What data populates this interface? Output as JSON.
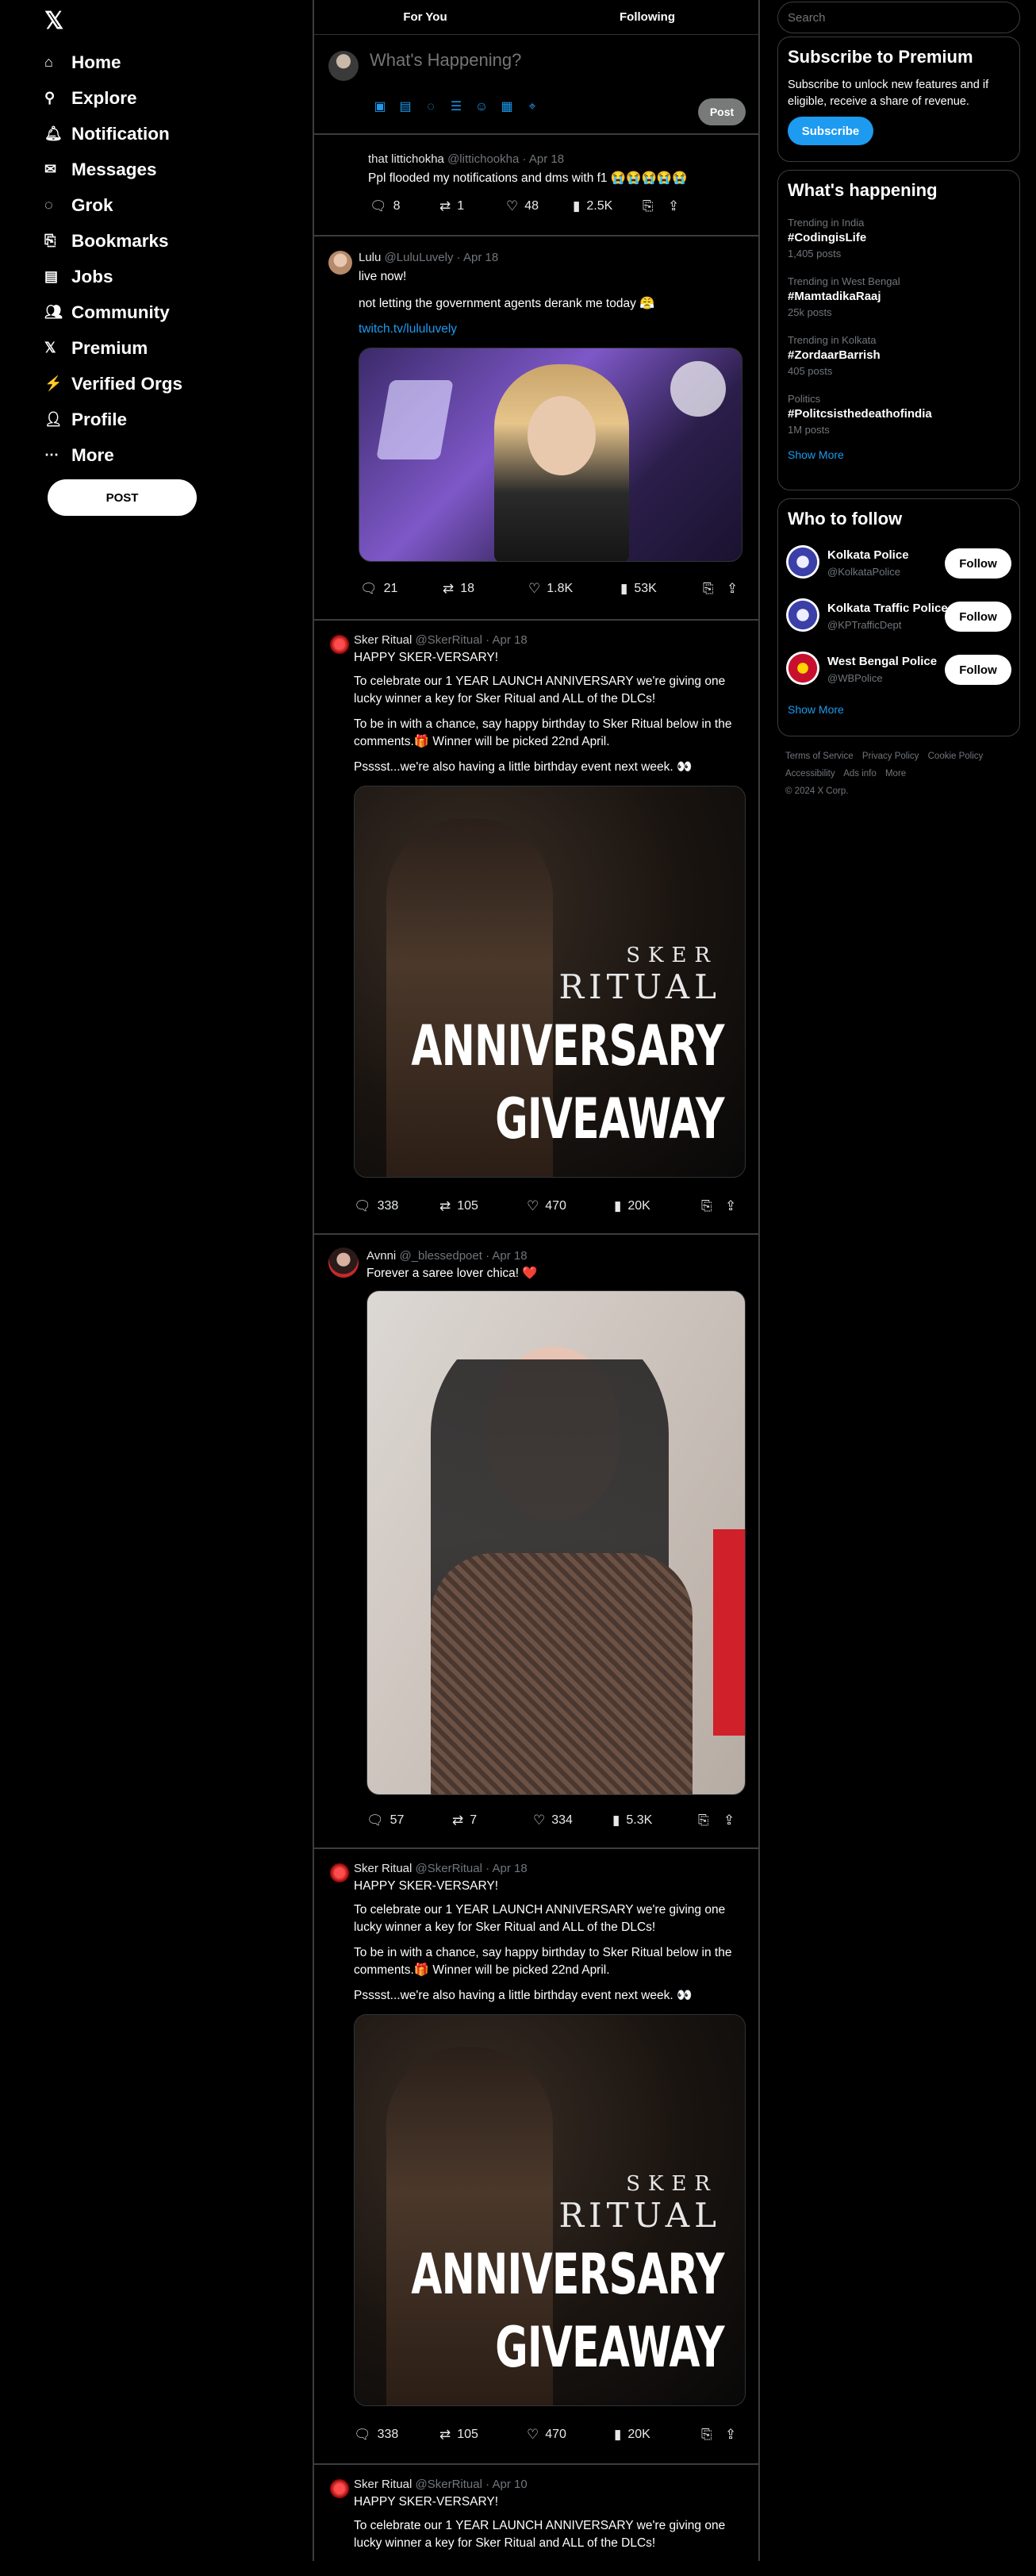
{
  "sidebar": {
    "logo": "𝕏",
    "items": [
      {
        "label": "Home",
        "icon": "⌂"
      },
      {
        "label": "Explore",
        "icon": "⚲"
      },
      {
        "label": "Notification",
        "icon": "🔔︎"
      },
      {
        "label": "Messages",
        "icon": "✉"
      },
      {
        "label": "Grok",
        "icon": "◌"
      },
      {
        "label": "Bookmarks",
        "icon": "⎘"
      },
      {
        "label": "Jobs",
        "icon": "▤"
      },
      {
        "label": "Community",
        "icon": "👥︎"
      },
      {
        "label": "Premium",
        "icon": "𝕏"
      },
      {
        "label": "Verified Orgs",
        "icon": "⚡"
      },
      {
        "label": "Profile",
        "icon": "👤︎"
      },
      {
        "label": "More",
        "icon": "⋯"
      }
    ],
    "post_label": "POST"
  },
  "tabs": {
    "for_you": "For You",
    "following": "Following"
  },
  "composer": {
    "placeholder": "What's Happening?",
    "post_label": "Post"
  },
  "tweets": [
    {
      "name": "that littichokha",
      "handle": "@littichookha",
      "date": "Apr 18",
      "text": "Ppl flooded my notifications and dms with f1 😭😭😭😭😭",
      "replies": "8",
      "retweets": "1",
      "likes": "48",
      "views": "2.5K"
    },
    {
      "name": "Lulu",
      "handle": "@LuluLuvely",
      "date": "Apr 18",
      "text1": "live now!",
      "text2": "not letting the government agents derank me today 😤",
      "link": "twitch.tv/lululuvely",
      "replies": "21",
      "retweets": "18",
      "likes": "1.8K",
      "views": "53K"
    },
    {
      "name": "Sker Ritual",
      "handle": "@SkerRitual",
      "date": "Apr 18",
      "text1": "HAPPY SKER-VERSARY!",
      "text2": "To celebrate our 1 YEAR LAUNCH ANNIVERSARY we're giving one lucky winner a key for Sker Ritual and ALL of the DLCs!",
      "text3": "To be in with a chance, say happy birthday to Sker Ritual below in the comments.🎁 Winner will be picked 22nd April.",
      "text4": "Psssst...we're also having a little birthday event next week. 👀",
      "img_brand_top": "SKER",
      "img_brand": "RITUAL",
      "img_line1": "ANNIVERSARY",
      "img_line2": "GIVEAWAY",
      "replies": "338",
      "retweets": "105",
      "likes": "470",
      "views": "20K"
    },
    {
      "name": "Avnni",
      "handle": "@_blessedpoet",
      "date": "Apr 18",
      "text1": "Forever a saree lover chica! ❤️",
      "replies": "57",
      "retweets": "7",
      "likes": "334",
      "views": "5.3K"
    },
    {
      "name": "Sker Ritual",
      "handle": "@SkerRitual",
      "date": "Apr 18",
      "text1": "HAPPY SKER-VERSARY!",
      "text2": "To celebrate our 1 YEAR LAUNCH ANNIVERSARY we're giving one lucky winner a key for Sker Ritual and ALL of the DLCs!",
      "text3": "To be in with a chance, say happy birthday to Sker Ritual below in the comments.🎁 Winner will be picked 22nd April.",
      "text4": "Psssst...we're also having a little birthday event next week. 👀",
      "img_brand_top": "SKER",
      "img_brand": "RITUAL",
      "img_line1": "ANNIVERSARY",
      "img_line2": "GIVEAWAY",
      "replies": "338",
      "retweets": "105",
      "likes": "470",
      "views": "20K"
    },
    {
      "name": "Sker Ritual",
      "handle": "@SkerRitual",
      "date": "Apr 10",
      "text1": "HAPPY SKER-VERSARY!",
      "text2": "To celebrate our 1 YEAR LAUNCH ANNIVERSARY we're giving one lucky winner a key for Sker Ritual and ALL of the DLCs!"
    }
  ],
  "right": {
    "search_placeholder": "Search",
    "premium": {
      "title": "Subscribe to Premium",
      "text": "Subscribe to unlock new features and if eligible, receive a share of revenue.",
      "button": "Subscribe"
    },
    "happening": {
      "title": "What's happening",
      "trends": [
        {
          "context": "Trending in India",
          "topic": "#CodingisLife",
          "posts": "1,405 posts"
        },
        {
          "context": "Trending in West Bengal",
          "topic": "#MamtadikaRaaj",
          "posts": "25k posts"
        },
        {
          "context": "Trending in Kolkata",
          "topic": "#ZordaarBarrish",
          "posts": "405 posts"
        },
        {
          "context": "Politics",
          "topic": "#Politcsisthedeathofindia",
          "posts": "1M posts"
        }
      ],
      "show_more": "Show More"
    },
    "who_to_follow": {
      "title": "Who to follow",
      "accounts": [
        {
          "name": "Kolkata Police",
          "handle": "@KolkataPolice"
        },
        {
          "name": "Kolkata Traffic Police",
          "handle": "@KPTrafficDept"
        },
        {
          "name": "West Bengal Police",
          "handle": "@WBPolice"
        }
      ],
      "follow_label": "Follow",
      "show_more": "Show More"
    },
    "footer": {
      "links1": [
        "Terms of Service",
        "Privacy Policy",
        "Cookie Policy"
      ],
      "links2": [
        "Accessibility",
        "Ads info",
        "More"
      ],
      "copyright": "© 2024 X Corp."
    }
  }
}
